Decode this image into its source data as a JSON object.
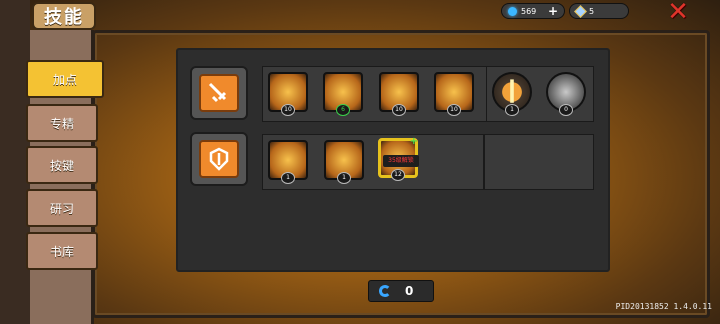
{
  "header": {
    "title": "技能",
    "gems": "569",
    "gems_plus": "+",
    "stones": "5",
    "close": "✕"
  },
  "side_tabs": [
    {
      "label": "加点",
      "active": true
    },
    {
      "label": "专精",
      "active": false
    },
    {
      "label": "按键",
      "active": false
    },
    {
      "label": "研习",
      "active": false
    },
    {
      "label": "书库",
      "active": false
    }
  ],
  "row1": {
    "skills": [
      {
        "level": "10"
      },
      {
        "level": "6"
      },
      {
        "level": "10"
      },
      {
        "level": "10"
      },
      {
        "level": "1"
      },
      {
        "level": "0"
      }
    ]
  },
  "row2": {
    "skills": [
      {
        "level": "1"
      },
      {
        "level": "1"
      },
      {
        "level": "12",
        "tag": "35级解锁"
      }
    ]
  },
  "points": {
    "value": "0"
  },
  "footer": {
    "version": "PID20131852 1.4.0.11"
  },
  "colors": {
    "accent": "#f4c233",
    "category": "#f08a2c"
  }
}
